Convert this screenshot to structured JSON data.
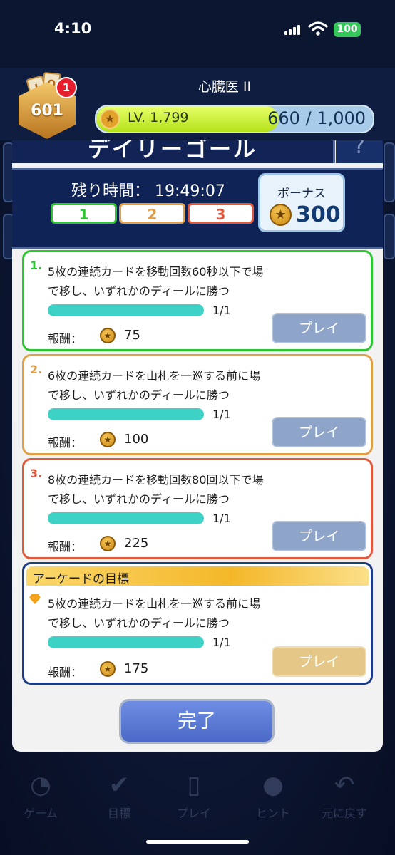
{
  "status_bar": {
    "time": "4:10",
    "battery": "100"
  },
  "player": {
    "level_badge": "601",
    "notification_count": "1",
    "name": "心臓医 II",
    "level_label": "LV. 1,799",
    "xp": "660 / 1,000",
    "xp_progress": 0.66,
    "badge_cards": [
      "J",
      "Q"
    ]
  },
  "banner": {
    "title": "デイリーゴール",
    "help_icon": "?"
  },
  "daily": {
    "timer_label": "残り時間：",
    "timer_value": "19:49:07",
    "tabs": [
      {
        "label": "1",
        "color": "#2fc431"
      },
      {
        "label": "2",
        "color": "#e0a048"
      },
      {
        "label": "3",
        "color": "#e2583c"
      }
    ],
    "bonus": {
      "label": "ボーナス",
      "value": "300"
    }
  },
  "goals": [
    {
      "num": "1.",
      "text_line1": "5枚の連続カードを移動回数60秒以下で場",
      "text_line2": "で移し、いずれかのディールに勝つ",
      "progress": "1/1",
      "reward_label": "報酬：",
      "reward": "75",
      "button": "プレイ",
      "color": "#2fc431"
    },
    {
      "num": "2.",
      "text_line1": "6枚の連続カードを山札を一巡する前に場",
      "text_line2": "で移し、いずれかのディールに勝つ",
      "progress": "1/1",
      "reward_label": "報酬：",
      "reward": "100",
      "button": "プレイ",
      "color": "#e0a048"
    },
    {
      "num": "3.",
      "text_line1": "8枚の連続カードを移動回数80回以下で場",
      "text_line2": "で移し、いずれかのディールに勝つ",
      "progress": "1/1",
      "reward_label": "報酬：",
      "reward": "225",
      "button": "プレイ",
      "color": "#e2583c"
    }
  ],
  "arcade": {
    "title": "アーケードの目標",
    "text_line1": "5枚の連続カードを山札を一巡する前に場",
    "text_line2": "で移し、いずれかのディールに勝つ",
    "progress": "1/1",
    "reward_label": "報酬：",
    "reward": "175",
    "button": "プレイ",
    "color": "#1d3a84"
  },
  "done_button": "完了",
  "bottom_nav": [
    {
      "label": "ゲーム",
      "icon": "game-icon"
    },
    {
      "label": "目標",
      "icon": "goals-checkmark-icon"
    },
    {
      "label": "プレイ",
      "icon": "cards-icon"
    },
    {
      "label": "ヒント",
      "icon": "lightbulb-icon"
    },
    {
      "label": "元に戻す",
      "icon": "undo-icon"
    }
  ]
}
